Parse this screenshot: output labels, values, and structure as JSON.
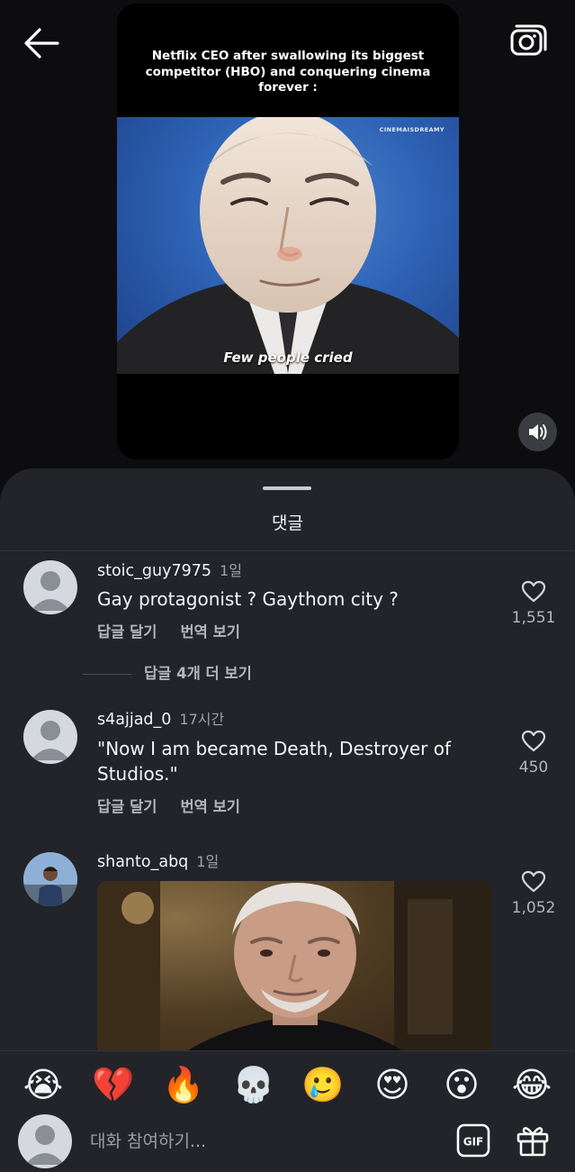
{
  "video": {
    "caption": "Netflix CEO after swallowing its biggest competitor (HBO) and conquering cinema forever :",
    "watermark": "CINEMAISDREAMY",
    "subtitle": "Few people cried"
  },
  "icons": {
    "back": "arrow-left-icon",
    "camera": "camera-icon",
    "mute": "speaker-icon",
    "like": "heart-outline-icon",
    "gif": "gif-icon",
    "gift": "gift-icon"
  },
  "sheet": {
    "title": "댓글"
  },
  "comments": [
    {
      "username": "stoic_guy7975",
      "time": "1일",
      "text": "Gay protagonist ? Gaythom city ?",
      "reply_label": "답글 달기",
      "translate_label": "번역 보기",
      "likes": "1,551"
    },
    {
      "username": "s4ajjad_0",
      "time": "17시간",
      "text": "\"Now I am became Death, Destroyer of Studios.\"",
      "reply_label": "답글 달기",
      "translate_label": "번역 보기",
      "likes": "450"
    },
    {
      "username": "shanto_abq",
      "time": "1일",
      "likes": "1,052"
    }
  ],
  "more_replies": "답글 4개 더 보기",
  "emojis": [
    "😭",
    "💔",
    "🔥",
    "💀",
    "🥲",
    "😍",
    "😮",
    "😂"
  ],
  "input": {
    "placeholder": "대화 참여하기..."
  }
}
